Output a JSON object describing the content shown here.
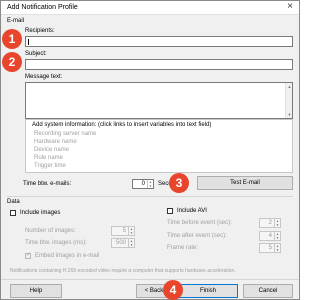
{
  "window": {
    "title": "Add Notification Profile",
    "close_symbol": "×"
  },
  "email": {
    "group_label": "E-mail",
    "recipients_label": "Recipients:",
    "subject_label": "Subject:",
    "message_label": "Message text:",
    "system_info_label": "Add system information: (click links to insert variables into text field)",
    "system_info_items": [
      "Recording server name",
      "Hardware name",
      "Device name",
      "Rule name",
      "Trigger time"
    ],
    "time_btw_label": "Time btw. e-mails:",
    "time_btw_value": "0",
    "time_btw_unit": "Seconds",
    "test_button": "Test E-mail"
  },
  "data": {
    "group_label": "Data",
    "include_images_label": "Include images",
    "num_images_label": "Number of images:",
    "num_images_value": "5",
    "time_btw_images_label": "Time btw. images (ms):",
    "time_btw_images_value": "500",
    "embed_images_label": "Embed images in e-mail",
    "include_avi_label": "Include AVI",
    "time_before_label": "Time before event (sec):",
    "time_before_value": "2",
    "time_after_label": "Time after event (sec):",
    "time_after_value": "4",
    "frame_rate_label": "Frame rate:",
    "frame_rate_value": "5",
    "h265_note": "Notifications containing H.265 encoded video require a computer that supports hardware acceleration."
  },
  "footer": {
    "help": "Help",
    "back": "< Back",
    "finish": "Finish",
    "cancel": "Cancel"
  },
  "callouts": [
    "1",
    "2",
    "3",
    "4"
  ],
  "colors": {
    "callout": "#e8452c",
    "primary_border": "#0078d7"
  }
}
